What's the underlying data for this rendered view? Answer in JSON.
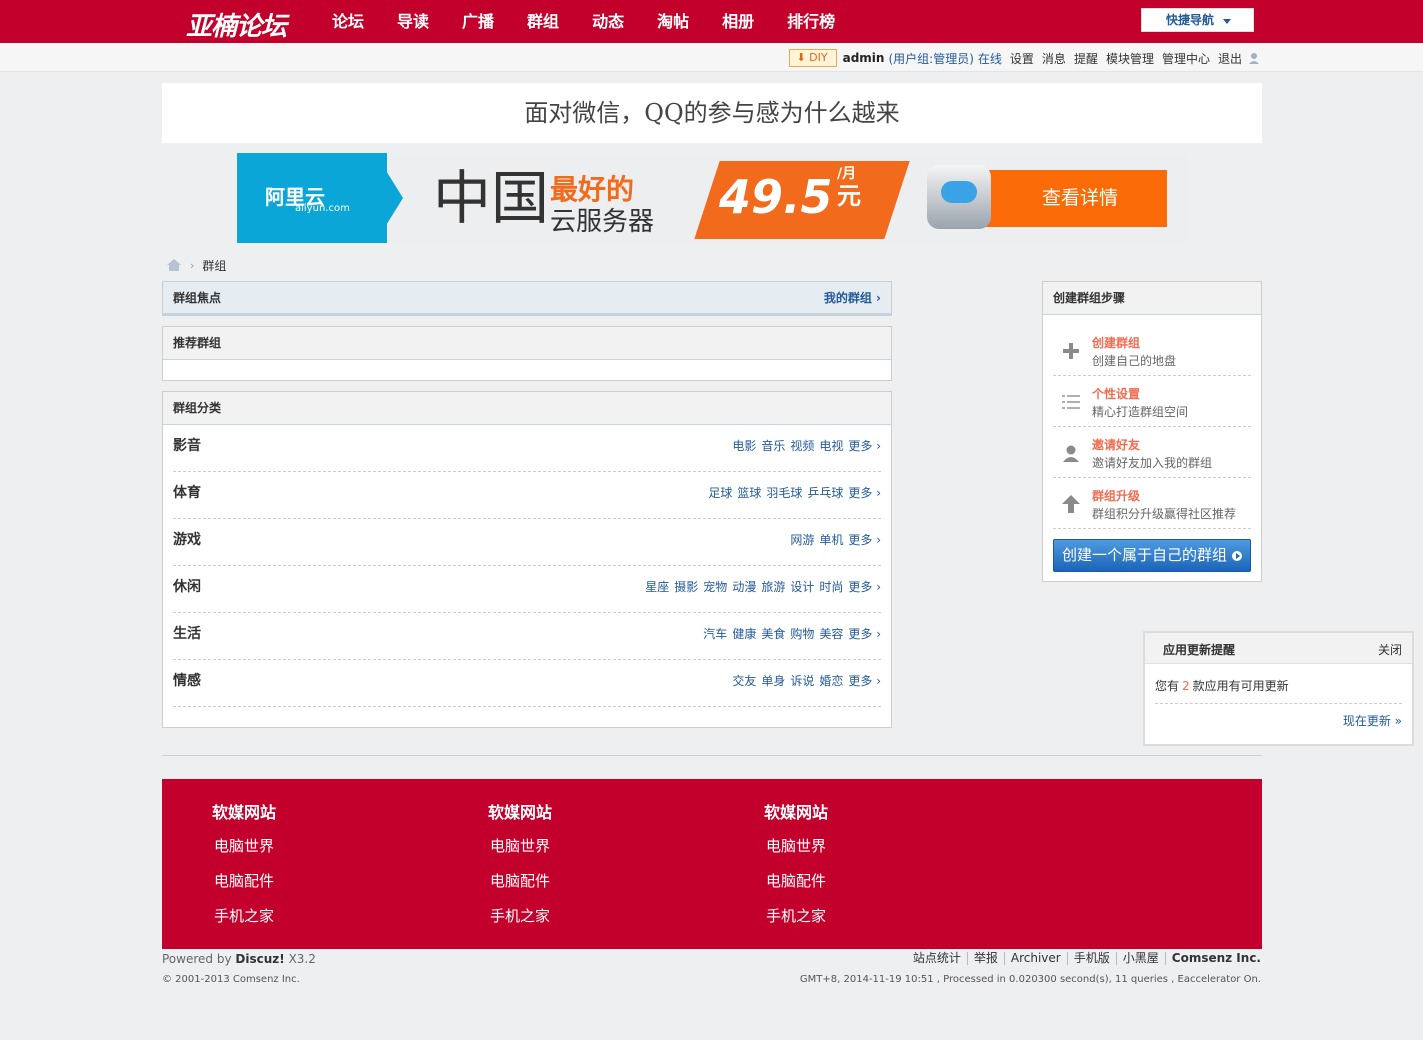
{
  "topbar": {
    "logo": "亚楠论坛",
    "nav": [
      "论坛",
      "导读",
      "广播",
      "群组",
      "动态",
      "淘帖",
      "相册",
      "排行榜"
    ],
    "quick_nav": "快捷导航"
  },
  "userbar": {
    "diy": "DIY",
    "username": "admin",
    "group": "(用户组:管理员)",
    "online": "在线",
    "links": [
      "设置",
      "消息",
      "提醒",
      "模块管理",
      "管理中心",
      "退出"
    ]
  },
  "headline": "面对微信，QQ的参与感为什么越来",
  "ad": {
    "brand": "阿里云",
    "brand_sub": "aliyun.com",
    "big": "中国",
    "best": "最好的",
    "server": "云服务器",
    "price": "49.5",
    "unit_top": "/月",
    "unit": "元",
    "button": "查看详情"
  },
  "breadcrumb": {
    "current": "群组"
  },
  "focus_panel": {
    "title": "群组焦点",
    "link": "我的群组 ›"
  },
  "recommend_panel": {
    "title": "推荐群组"
  },
  "category_panel": {
    "title": "群组分类",
    "more": "更多 ›",
    "rows": [
      {
        "name": "影音",
        "links": [
          "电影",
          "音乐",
          "视频",
          "电视"
        ]
      },
      {
        "name": "体育",
        "links": [
          "足球",
          "篮球",
          "羽毛球",
          "乒乓球"
        ]
      },
      {
        "name": "游戏",
        "links": [
          "网游",
          "单机"
        ]
      },
      {
        "name": "休闲",
        "links": [
          "星座",
          "摄影",
          "宠物",
          "动漫",
          "旅游",
          "设计",
          "时尚"
        ]
      },
      {
        "name": "生活",
        "links": [
          "汽车",
          "健康",
          "美食",
          "购物",
          "美容"
        ]
      },
      {
        "name": "情感",
        "links": [
          "交友",
          "单身",
          "诉说",
          "婚恋"
        ]
      }
    ]
  },
  "steps_panel": {
    "title": "创建群组步骤",
    "steps": [
      {
        "title": "创建群组",
        "desc": "创建自己的地盘",
        "icon": "plus-icon"
      },
      {
        "title": "个性设置",
        "desc": "精心打造群组空间",
        "icon": "list-icon"
      },
      {
        "title": "邀请好友",
        "desc": "邀请好友加入我的群组",
        "icon": "user-icon"
      },
      {
        "title": "群组升级",
        "desc": "群组积分升级赢得社区推荐",
        "icon": "arrow-up-icon"
      }
    ],
    "button": "创建一个属于自己的群组"
  },
  "notice": {
    "title": "应用更新提醒",
    "close": "关闭",
    "text_before": "您有",
    "count": "2",
    "text_after": "款应用有可用更新",
    "link": "现在更新 »"
  },
  "footer": {
    "columns": [
      {
        "title": "软媒网站",
        "links": [
          "电脑世界",
          "电脑配件",
          "手机之家"
        ]
      },
      {
        "title": "软媒网站",
        "links": [
          "电脑世界",
          "电脑配件",
          "手机之家"
        ]
      },
      {
        "title": "软媒网站",
        "links": [
          "电脑世界",
          "电脑配件",
          "手机之家"
        ]
      }
    ],
    "powered_prefix": "Powered by",
    "powered_brand": "Discuz!",
    "powered_version": "X3.2",
    "copyright": "© 2001-2013 Comsenz Inc.",
    "links": [
      "站点统计",
      "举报",
      "Archiver",
      "手机版",
      "小黑屋"
    ],
    "company": "Comsenz Inc.",
    "gmt": "GMT+8, 2014-11-19 10:51 , Processed in 0.020300 second(s), 11 queries , Eaccelerator On."
  },
  "colors": {
    "brand_red": "#c3002b",
    "link_blue": "#245b9b",
    "accent_orange": "#f26c4f"
  }
}
